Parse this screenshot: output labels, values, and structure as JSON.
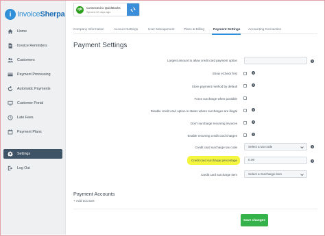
{
  "brand": {
    "name_prefix": "Invoice",
    "name_suffix": "Sherpa"
  },
  "sidebar": {
    "items": [
      {
        "label": "Home",
        "icon": "home-icon",
        "active": false
      },
      {
        "label": "Invoice Reminders",
        "icon": "document-icon",
        "active": false
      },
      {
        "label": "Customers",
        "icon": "users-icon",
        "active": false
      },
      {
        "label": "Payment Processing",
        "icon": "credit-card-icon",
        "active": false
      },
      {
        "label": "Automatic Payments",
        "icon": "refresh-icon",
        "active": false
      },
      {
        "label": "Customer Portal",
        "icon": "monitor-icon",
        "active": false
      },
      {
        "label": "Late Fees",
        "icon": "clock-icon",
        "active": false
      },
      {
        "label": "Payment Plans",
        "icon": "calendar-icon",
        "active": false
      },
      {
        "label": "Settings",
        "icon": "gear-icon",
        "active": true
      },
      {
        "label": "Log Out",
        "icon": "logout-icon",
        "active": false
      }
    ]
  },
  "quickbooks": {
    "logo_text": "qb",
    "status": "Connected to QuickBooks",
    "synced": "Synced 42 days ago"
  },
  "tabs": [
    {
      "label": "Company Information"
    },
    {
      "label": "Account Settings"
    },
    {
      "label": "User Management"
    },
    {
      "label": "Plans & Billing"
    },
    {
      "label": "Payment Settings"
    },
    {
      "label": "Accounting Connection"
    }
  ],
  "page_title": "Payment Settings",
  "settings": {
    "largest_amount_label": "Largest amount to allow credit card payment option",
    "largest_amount_value": "",
    "show_echeck_label": "Show eCheck first",
    "store_method_label": "Store payment method by default",
    "force_surcharge_label": "Force surcharge when possible",
    "disable_cc_label": "Disable credit card option in states where surcharges are illegal",
    "dont_surcharge_label": "Don't surcharge recurring invoices",
    "enable_recurring_label": "Enable recurring credit card charges",
    "tax_code_label": "Credit card surcharge tax code",
    "tax_code_value": "Select a tax code",
    "percentage_label": "Credit card surcharge percentage",
    "percentage_value": "0.00",
    "item_label": "Credit card surcharge item",
    "item_value": "Select a Surcharge item",
    "help_glyph": "?"
  },
  "payment_accounts": {
    "title": "Payment Accounts",
    "add_label": "+ Add account"
  },
  "save_label": "Save changes",
  "colors": {
    "accent": "#2f8fd8",
    "sidebar_active": "#3f5366",
    "save": "#35b24a",
    "highlight": "#f4f53f",
    "qb_green": "#2ca01c"
  }
}
